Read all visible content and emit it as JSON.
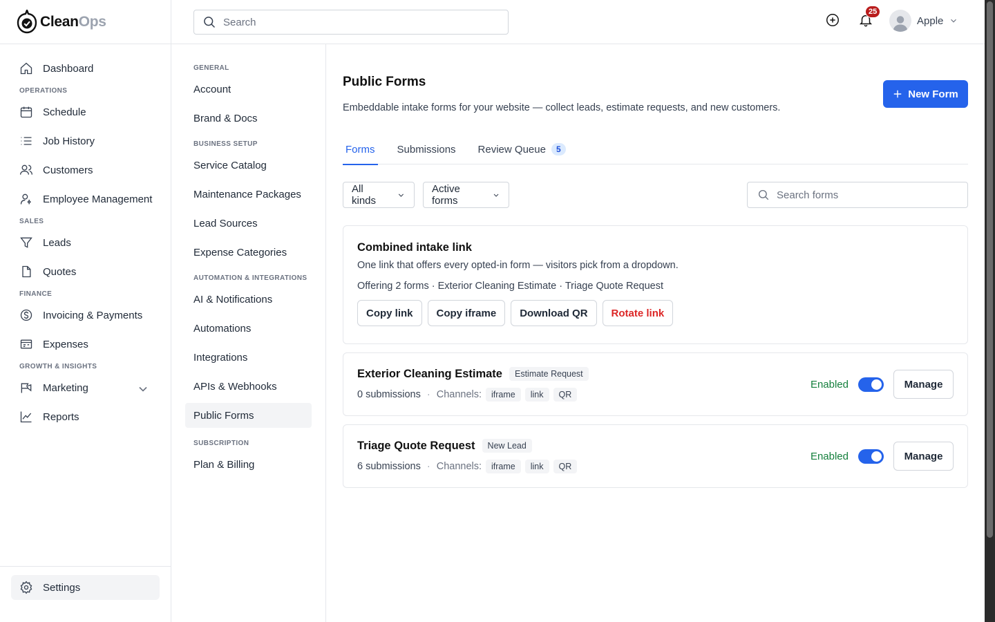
{
  "brand": {
    "name_main": "Clean",
    "name_accent": "Ops"
  },
  "topbar": {
    "search_placeholder": "Search",
    "notification_count": "25",
    "user_name": "Apple"
  },
  "sidebar": {
    "dashboard": "Dashboard",
    "operations_heading": "OPERATIONS",
    "schedule": "Schedule",
    "job_history": "Job History",
    "customers": "Customers",
    "employee_management": "Employee Management",
    "sales_heading": "SALES",
    "leads": "Leads",
    "quotes": "Quotes",
    "finance_heading": "FINANCE",
    "invoicing": "Invoicing & Payments",
    "expenses": "Expenses",
    "growth_heading": "GROWTH & INSIGHTS",
    "marketing": "Marketing",
    "reports": "Reports",
    "settings": "Settings"
  },
  "settings_nav": {
    "general_heading": "GENERAL",
    "account": "Account",
    "brand_docs": "Brand & Docs",
    "business_heading": "BUSINESS SETUP",
    "service_catalog": "Service Catalog",
    "maintenance_packages": "Maintenance Packages",
    "lead_sources": "Lead Sources",
    "expense_categories": "Expense Categories",
    "automation_heading": "AUTOMATION & INTEGRATIONS",
    "ai_notifications": "AI & Notifications",
    "automations": "Automations",
    "integrations": "Integrations",
    "apis_webhooks": "APIs & Webhooks",
    "public_forms": "Public Forms",
    "subscription_heading": "SUBSCRIPTION",
    "plan_billing": "Plan & Billing"
  },
  "page": {
    "title": "Public Forms",
    "description": "Embeddable intake forms for your website — collect leads, estimate requests, and new customers.",
    "new_form_label": "New Form"
  },
  "tabs": {
    "forms": "Forms",
    "submissions": "Submissions",
    "review_queue": "Review Queue",
    "review_queue_count": "5"
  },
  "filters": {
    "kind": "All kinds",
    "status": "Active forms",
    "search_placeholder": "Search forms"
  },
  "combined": {
    "title": "Combined intake link",
    "description": "One link that offers every opted-in form — visitors pick from a dropdown.",
    "offering": "Offering 2 forms · Exterior Cleaning Estimate · Triage Quote Request",
    "copy_link": "Copy link",
    "copy_iframe": "Copy iframe",
    "download_qr": "Download QR",
    "rotate_link": "Rotate link"
  },
  "forms": [
    {
      "title": "Exterior Cleaning Estimate",
      "kind": "Estimate Request",
      "submissions": "0 submissions",
      "channels_label": "Channels:",
      "channels": [
        "iframe",
        "link",
        "QR"
      ],
      "status": "Enabled",
      "manage": "Manage"
    },
    {
      "title": "Triage Quote Request",
      "kind": "New Lead",
      "submissions": "6 submissions",
      "channels_label": "Channels:",
      "channels": [
        "iframe",
        "link",
        "QR"
      ],
      "status": "Enabled",
      "manage": "Manage"
    }
  ],
  "colors": {
    "accent": "#2563eb",
    "enabled_text": "#15803d",
    "danger": "#dc2626",
    "badge": "#b91c1c"
  }
}
